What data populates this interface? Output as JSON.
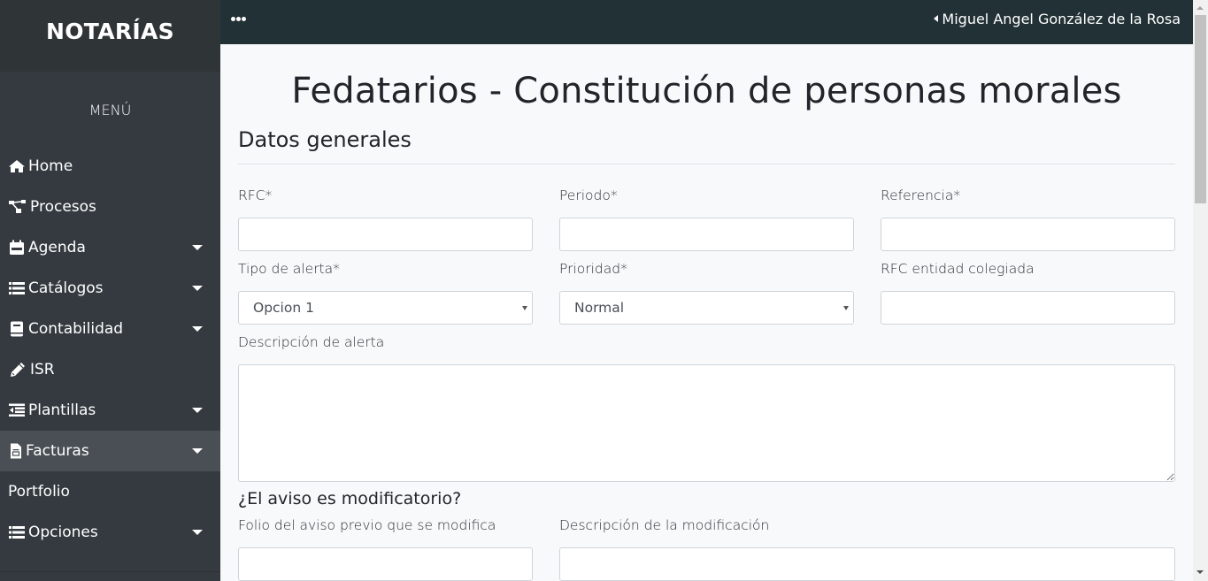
{
  "sidebar": {
    "brand": "NOTARÍAS",
    "menu_title": "MENÚ",
    "items": [
      {
        "label": "Home",
        "icon": "home-icon",
        "has_submenu": false
      },
      {
        "label": "Procesos",
        "icon": "sitemap-icon",
        "has_submenu": false
      },
      {
        "label": "Agenda",
        "icon": "calendar-icon",
        "has_submenu": true
      },
      {
        "label": "Catálogos",
        "icon": "list-icon",
        "has_submenu": true
      },
      {
        "label": "Contabilidad",
        "icon": "book-icon",
        "has_submenu": true
      },
      {
        "label": "ISR",
        "icon": "pencil-icon",
        "has_submenu": false
      },
      {
        "label": "Plantillas",
        "icon": "indent-icon",
        "has_submenu": true
      },
      {
        "label": "Facturas",
        "icon": "file-icon",
        "has_submenu": true,
        "active": true
      },
      {
        "label": "Portfolio",
        "icon": "",
        "has_submenu": false
      },
      {
        "label": "Opciones",
        "icon": "list-icon",
        "has_submenu": true
      }
    ]
  },
  "topbar": {
    "menu_toggle_icon": "ellipsis-icon",
    "user_name": "Miguel Angel González de la Rosa"
  },
  "page": {
    "title": "Fedatarios - Constitución de personas morales",
    "section_title": "Datos generales",
    "fields": {
      "rfc": {
        "label": "RFC*",
        "value": ""
      },
      "periodo": {
        "label": "Periodo*",
        "value": ""
      },
      "referencia": {
        "label": "Referencia*",
        "value": ""
      },
      "tipo_alerta": {
        "label": "Tipo de alerta*",
        "selected": "Opcion 1"
      },
      "prioridad": {
        "label": "Prioridad*",
        "selected": "Normal"
      },
      "rfc_entidad": {
        "label": "RFC entidad colegiada",
        "value": ""
      },
      "descripcion_alerta": {
        "label": "Descripción de alerta",
        "value": ""
      }
    },
    "modificatorio": {
      "question": "¿El aviso es modificatorio?",
      "folio": {
        "label": "Folio del aviso previo que se modifica",
        "value": ""
      },
      "descripcion": {
        "label": "Descripción de la modificación",
        "value": ""
      }
    }
  }
}
